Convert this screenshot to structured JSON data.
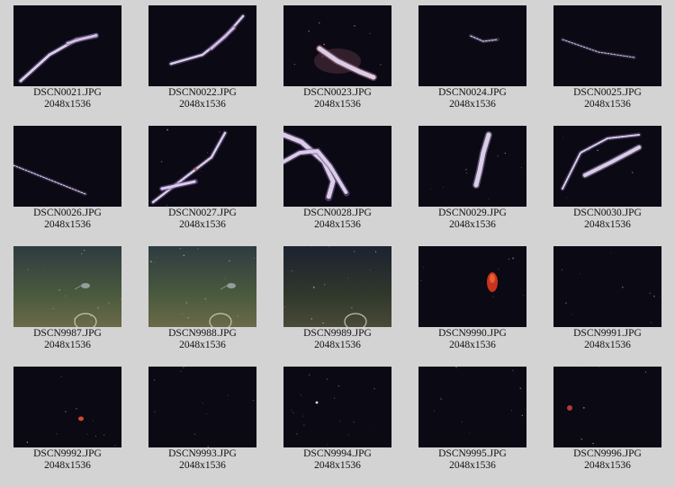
{
  "gallery": {
    "items": [
      {
        "filename": "DSCN0021.JPG",
        "dimensions": "2048x1536",
        "scene": "siphonophore-diagonal"
      },
      {
        "filename": "DSCN0022.JPG",
        "dimensions": "2048x1536",
        "scene": "siphonophore-diagonal"
      },
      {
        "filename": "DSCN0023.JPG",
        "dimensions": "2048x1536",
        "scene": "siphonophore-closeup"
      },
      {
        "filename": "DSCN0024.JPG",
        "dimensions": "2048x1536",
        "scene": "small-faint-creature"
      },
      {
        "filename": "DSCN0025.JPG",
        "dimensions": "2048x1536",
        "scene": "faint-streak"
      },
      {
        "filename": "DSCN0026.JPG",
        "dimensions": "2048x1536",
        "scene": "faint-streak-low"
      },
      {
        "filename": "DSCN0027.JPG",
        "dimensions": "2048x1536",
        "scene": "siphonophore-two"
      },
      {
        "filename": "DSCN0028.JPG",
        "dimensions": "2048x1536",
        "scene": "siphonophore-tangled"
      },
      {
        "filename": "DSCN0029.JPG",
        "dimensions": "2048x1536",
        "scene": "siphonophore-vertical"
      },
      {
        "filename": "DSCN0030.JPG",
        "dimensions": "2048x1536",
        "scene": "siphonophore-arc"
      },
      {
        "filename": "DSCN9987.JPG",
        "dimensions": "2048x1536",
        "scene": "seafloor-ring"
      },
      {
        "filename": "DSCN9988.JPG",
        "dimensions": "2048x1536",
        "scene": "seafloor-ring"
      },
      {
        "filename": "DSCN9989.JPG",
        "dimensions": "2048x1536",
        "scene": "seafloor-ring-dark"
      },
      {
        "filename": "DSCN9990.JPG",
        "dimensions": "2048x1536",
        "scene": "red-jelly"
      },
      {
        "filename": "DSCN9991.JPG",
        "dimensions": "2048x1536",
        "scene": "dark-water"
      },
      {
        "filename": "DSCN9992.JPG",
        "dimensions": "2048x1536",
        "scene": "small-red-speck"
      },
      {
        "filename": "DSCN9993.JPG",
        "dimensions": "2048x1536",
        "scene": "dark-water"
      },
      {
        "filename": "DSCN9994.JPG",
        "dimensions": "2048x1536",
        "scene": "dark-water-specks"
      },
      {
        "filename": "DSCN9995.JPG",
        "dimensions": "2048x1536",
        "scene": "dark-water"
      },
      {
        "filename": "DSCN9996.JPG",
        "dimensions": "2048x1536",
        "scene": "small-red-dot"
      }
    ]
  }
}
